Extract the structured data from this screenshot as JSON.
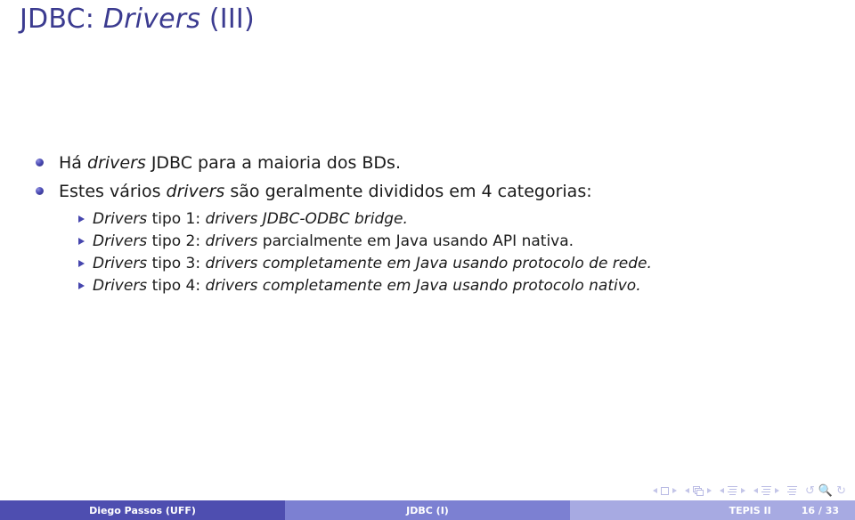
{
  "slide": {
    "title": {
      "prefix": "JDBC: ",
      "emphasis": "Drivers",
      "suffix": " (III)"
    },
    "bullets": [
      {
        "segments": [
          {
            "text": "Há ",
            "italic": false
          },
          {
            "text": "drivers",
            "italic": true
          },
          {
            "text": " JDBC para a maioria dos BDs.",
            "italic": false
          }
        ]
      },
      {
        "segments": [
          {
            "text": "Estes vários ",
            "italic": false
          },
          {
            "text": "drivers",
            "italic": true
          },
          {
            "text": " são geralmente divididos em 4 categorias:",
            "italic": false
          }
        ],
        "sub": [
          {
            "segments": [
              {
                "text": "Drivers",
                "italic": true
              },
              {
                "text": " tipo 1: ",
                "italic": false
              },
              {
                "text": "drivers JDBC-ODBC bridge.",
                "italic": true
              }
            ]
          },
          {
            "segments": [
              {
                "text": "Drivers",
                "italic": true
              },
              {
                "text": " tipo 2: ",
                "italic": false
              },
              {
                "text": "drivers",
                "italic": true
              },
              {
                "text": " parcialmente em Java usando API nativa.",
                "italic": false
              }
            ]
          },
          {
            "segments": [
              {
                "text": "Drivers",
                "italic": true
              },
              {
                "text": " tipo 3: ",
                "italic": false
              },
              {
                "text": "drivers completamente em Java usando protocolo de rede.",
                "italic": true
              }
            ]
          },
          {
            "segments": [
              {
                "text": "Drivers",
                "italic": true
              },
              {
                "text": " tipo 4: ",
                "italic": false
              },
              {
                "text": "drivers completamente em Java usando protocolo nativo.",
                "italic": true
              }
            ]
          }
        ]
      }
    ]
  },
  "navigation": {
    "icons": [
      "prev-slide-arrow-icon",
      "slide-square-icon",
      "next-slide-arrow-icon",
      "prev-frame-arrow-icon",
      "frames-stack-icon",
      "next-frame-arrow-icon",
      "prev-subsection-arrow-icon",
      "subsection-lines-icon",
      "next-subsection-arrow-icon",
      "prev-section-arrow-icon",
      "section-lines-icon",
      "next-section-arrow-icon",
      "presentation-lines-icon",
      "back-arrow-icon",
      "search-icon",
      "forward-arrow-icon"
    ]
  },
  "footer": {
    "author": "Diego Passos  (UFF)",
    "subject": "JDBC (I)",
    "course": "TEPIS II",
    "page": "16 / 33"
  },
  "colors": {
    "title": "#3b3b90",
    "bullet": "#4646ae",
    "footer_left": "#4e4eb0",
    "footer_mid": "#7c80d2",
    "footer_right": "#a7aae2",
    "nav_icon": "#b9bbe4"
  }
}
